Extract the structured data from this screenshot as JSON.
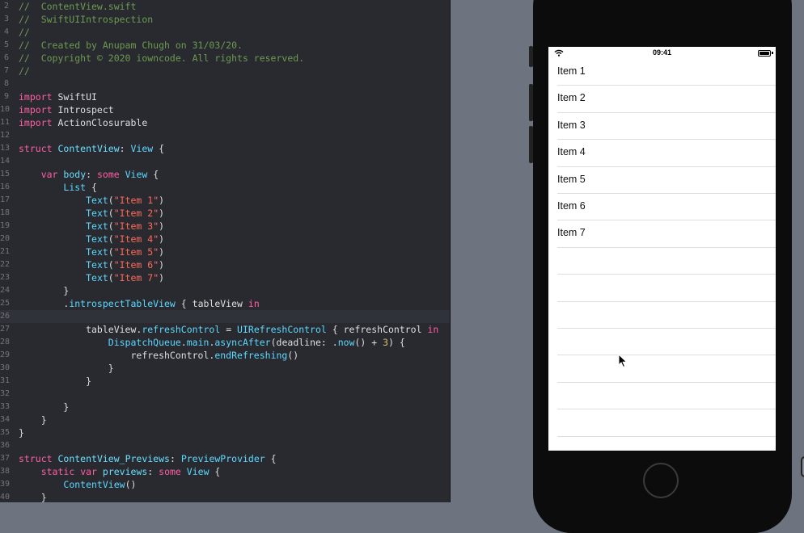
{
  "editor": {
    "active_line_number": "26",
    "lines": [
      {
        "n": "2",
        "segments": [
          {
            "t": "//  ContentView.swift",
            "c": "c-comment"
          }
        ]
      },
      {
        "n": "3",
        "segments": [
          {
            "t": "//  SwiftUIIntrospection",
            "c": "c-comment"
          }
        ]
      },
      {
        "n": "4",
        "segments": [
          {
            "t": "//",
            "c": "c-comment"
          }
        ]
      },
      {
        "n": "5",
        "segments": [
          {
            "t": "//  Created by Anupam Chugh on 31/03/20.",
            "c": "c-comment"
          }
        ]
      },
      {
        "n": "6",
        "segments": [
          {
            "t": "//  Copyright © 2020 iowncode. All rights reserved.",
            "c": "c-comment"
          }
        ]
      },
      {
        "n": "7",
        "segments": [
          {
            "t": "//",
            "c": "c-comment"
          }
        ]
      },
      {
        "n": "8",
        "segments": []
      },
      {
        "n": "9",
        "segments": [
          {
            "t": "import",
            "c": "c-kw"
          },
          {
            "t": " SwiftUI",
            "c": ""
          }
        ]
      },
      {
        "n": "10",
        "segments": [
          {
            "t": "import",
            "c": "c-kw"
          },
          {
            "t": " Introspect",
            "c": ""
          }
        ]
      },
      {
        "n": "11",
        "segments": [
          {
            "t": "import",
            "c": "c-kw"
          },
          {
            "t": " ActionClosurable",
            "c": ""
          }
        ]
      },
      {
        "n": "12",
        "segments": []
      },
      {
        "n": "13",
        "segments": [
          {
            "t": "struct",
            "c": "c-kw"
          },
          {
            "t": " ",
            "c": ""
          },
          {
            "t": "ContentView",
            "c": "c-typedecl"
          },
          {
            "t": ": ",
            "c": ""
          },
          {
            "t": "View",
            "c": "c-type"
          },
          {
            "t": " {",
            "c": ""
          }
        ]
      },
      {
        "n": "14",
        "segments": []
      },
      {
        "n": "15",
        "segments": [
          {
            "t": "    ",
            "c": ""
          },
          {
            "t": "var",
            "c": "c-kw"
          },
          {
            "t": " ",
            "c": ""
          },
          {
            "t": "body",
            "c": "c-typedecl"
          },
          {
            "t": ": ",
            "c": ""
          },
          {
            "t": "some",
            "c": "c-kw"
          },
          {
            "t": " ",
            "c": ""
          },
          {
            "t": "View",
            "c": "c-type"
          },
          {
            "t": " {",
            "c": ""
          }
        ]
      },
      {
        "n": "16",
        "segments": [
          {
            "t": "        ",
            "c": ""
          },
          {
            "t": "List",
            "c": "c-type"
          },
          {
            "t": " {",
            "c": ""
          }
        ]
      },
      {
        "n": "17",
        "segments": [
          {
            "t": "            ",
            "c": ""
          },
          {
            "t": "Text",
            "c": "c-type"
          },
          {
            "t": "(",
            "c": ""
          },
          {
            "t": "\"Item 1\"",
            "c": "c-str"
          },
          {
            "t": ")",
            "c": ""
          }
        ]
      },
      {
        "n": "18",
        "segments": [
          {
            "t": "            ",
            "c": ""
          },
          {
            "t": "Text",
            "c": "c-type"
          },
          {
            "t": "(",
            "c": ""
          },
          {
            "t": "\"Item 2\"",
            "c": "c-str"
          },
          {
            "t": ")",
            "c": ""
          }
        ]
      },
      {
        "n": "19",
        "segments": [
          {
            "t": "            ",
            "c": ""
          },
          {
            "t": "Text",
            "c": "c-type"
          },
          {
            "t": "(",
            "c": ""
          },
          {
            "t": "\"Item 3\"",
            "c": "c-str"
          },
          {
            "t": ")",
            "c": ""
          }
        ]
      },
      {
        "n": "20",
        "segments": [
          {
            "t": "            ",
            "c": ""
          },
          {
            "t": "Text",
            "c": "c-type"
          },
          {
            "t": "(",
            "c": ""
          },
          {
            "t": "\"Item 4\"",
            "c": "c-str"
          },
          {
            "t": ")",
            "c": ""
          }
        ]
      },
      {
        "n": "21",
        "segments": [
          {
            "t": "            ",
            "c": ""
          },
          {
            "t": "Text",
            "c": "c-type"
          },
          {
            "t": "(",
            "c": ""
          },
          {
            "t": "\"Item 5\"",
            "c": "c-str"
          },
          {
            "t": ")",
            "c": ""
          }
        ]
      },
      {
        "n": "22",
        "segments": [
          {
            "t": "            ",
            "c": ""
          },
          {
            "t": "Text",
            "c": "c-type"
          },
          {
            "t": "(",
            "c": ""
          },
          {
            "t": "\"Item 6\"",
            "c": "c-str"
          },
          {
            "t": ")",
            "c": ""
          }
        ]
      },
      {
        "n": "23",
        "segments": [
          {
            "t": "            ",
            "c": ""
          },
          {
            "t": "Text",
            "c": "c-type"
          },
          {
            "t": "(",
            "c": ""
          },
          {
            "t": "\"Item 7\"",
            "c": "c-str"
          },
          {
            "t": ")",
            "c": ""
          }
        ]
      },
      {
        "n": "24",
        "segments": [
          {
            "t": "        }",
            "c": ""
          }
        ]
      },
      {
        "n": "25",
        "segments": [
          {
            "t": "        .",
            "c": ""
          },
          {
            "t": "introspectTableView",
            "c": "c-type"
          },
          {
            "t": " { tableView ",
            "c": ""
          },
          {
            "t": "in",
            "c": "c-kw"
          }
        ]
      },
      {
        "n": "26",
        "segments": []
      },
      {
        "n": "27",
        "segments": [
          {
            "t": "            tableView.",
            "c": ""
          },
          {
            "t": "refreshControl",
            "c": "c-type"
          },
          {
            "t": " = ",
            "c": ""
          },
          {
            "t": "UIRefreshControl",
            "c": "c-type"
          },
          {
            "t": " { refreshControl ",
            "c": ""
          },
          {
            "t": "in",
            "c": "c-kw"
          }
        ]
      },
      {
        "n": "28",
        "segments": [
          {
            "t": "                ",
            "c": ""
          },
          {
            "t": "DispatchQueue",
            "c": "c-type"
          },
          {
            "t": ".",
            "c": ""
          },
          {
            "t": "main",
            "c": "c-type"
          },
          {
            "t": ".",
            "c": ""
          },
          {
            "t": "asyncAfter",
            "c": "c-type"
          },
          {
            "t": "(deadline: .",
            "c": ""
          },
          {
            "t": "now",
            "c": "c-type"
          },
          {
            "t": "() + ",
            "c": ""
          },
          {
            "t": "3",
            "c": "c-num"
          },
          {
            "t": ") {",
            "c": ""
          }
        ]
      },
      {
        "n": "29",
        "segments": [
          {
            "t": "                    refreshControl.",
            "c": ""
          },
          {
            "t": "endRefreshing",
            "c": "c-type"
          },
          {
            "t": "()",
            "c": ""
          }
        ]
      },
      {
        "n": "30",
        "segments": [
          {
            "t": "                }",
            "c": ""
          }
        ]
      },
      {
        "n": "31",
        "segments": [
          {
            "t": "            }",
            "c": ""
          }
        ]
      },
      {
        "n": "32",
        "segments": []
      },
      {
        "n": "33",
        "segments": [
          {
            "t": "        }",
            "c": ""
          }
        ]
      },
      {
        "n": "34",
        "segments": [
          {
            "t": "    }",
            "c": ""
          }
        ]
      },
      {
        "n": "35",
        "segments": [
          {
            "t": "}",
            "c": ""
          }
        ]
      },
      {
        "n": "36",
        "segments": []
      },
      {
        "n": "37",
        "segments": [
          {
            "t": "struct",
            "c": "c-kw"
          },
          {
            "t": " ",
            "c": ""
          },
          {
            "t": "ContentView_Previews",
            "c": "c-typedecl"
          },
          {
            "t": ": ",
            "c": ""
          },
          {
            "t": "PreviewProvider",
            "c": "c-type"
          },
          {
            "t": " {",
            "c": ""
          }
        ]
      },
      {
        "n": "38",
        "segments": [
          {
            "t": "    ",
            "c": ""
          },
          {
            "t": "static",
            "c": "c-kw"
          },
          {
            "t": " ",
            "c": ""
          },
          {
            "t": "var",
            "c": "c-kw"
          },
          {
            "t": " ",
            "c": ""
          },
          {
            "t": "previews",
            "c": "c-typedecl"
          },
          {
            "t": ": ",
            "c": ""
          },
          {
            "t": "some",
            "c": "c-kw"
          },
          {
            "t": " ",
            "c": ""
          },
          {
            "t": "View",
            "c": "c-type"
          },
          {
            "t": " {",
            "c": ""
          }
        ]
      },
      {
        "n": "39",
        "segments": [
          {
            "t": "        ",
            "c": ""
          },
          {
            "t": "ContentView",
            "c": "c-type"
          },
          {
            "t": "()",
            "c": ""
          }
        ]
      },
      {
        "n": "40",
        "segments": [
          {
            "t": "    }",
            "c": ""
          }
        ]
      }
    ]
  },
  "simulator": {
    "status_time": "09:41",
    "list_items": [
      "Item 1",
      "Item 2",
      "Item 3",
      "Item 4",
      "Item 5",
      "Item 6",
      "Item 7"
    ],
    "empty_row_count": 8
  },
  "colors": {
    "editor_background": "#292a30",
    "canvas_background": "#6e7380",
    "comment": "#6c9a52",
    "keyword": "#fc5fa3",
    "type": "#5dd8ff",
    "string": "#fc6a5d",
    "number": "#d0bf69"
  }
}
